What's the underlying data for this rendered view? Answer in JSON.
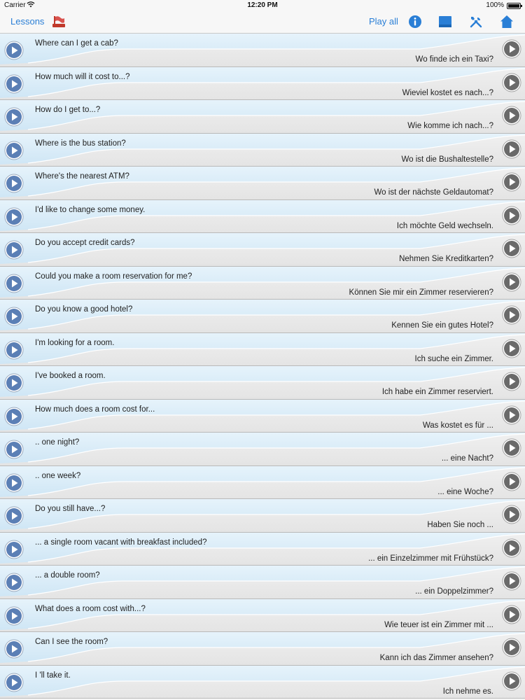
{
  "status": {
    "carrier": "Carrier",
    "time": "12:20 PM",
    "battery": "100%"
  },
  "nav": {
    "lessons_label": "Lessons",
    "play_all_label": "Play all",
    "icons": [
      "flag-icon",
      "info-icon",
      "square-icon",
      "tools-icon",
      "home-icon"
    ],
    "accent": "#2a7fd6"
  },
  "colors": {
    "row_top": "#cfe6f5",
    "row_bottom": "#e4e4e4",
    "play_left": "#5b7fb5",
    "play_right": "#6a6a6a"
  },
  "phrases": [
    {
      "en": "Where can I get a cab?",
      "de": "Wo finde ich ein Taxi?"
    },
    {
      "en": "How much will it cost to...?",
      "de": "Wieviel kostet es nach...?"
    },
    {
      "en": "How do I get to...?",
      "de": "Wie komme ich nach...?"
    },
    {
      "en": "Where is the bus station?",
      "de": "Wo ist die Bushaltestelle?"
    },
    {
      "en": "Where's the nearest ATM?",
      "de": "Wo ist der nächste Geldautomat?"
    },
    {
      "en": "I'd like to change some money.",
      "de": "Ich möchte Geld wechseln."
    },
    {
      "en": "Do you accept credit cards?",
      "de": "Nehmen Sie Kreditkarten?"
    },
    {
      "en": "Could you make a room reservation for me?",
      "de": "Können Sie mir ein Zimmer reservieren?"
    },
    {
      "en": "Do you know a good hotel?",
      "de": "Kennen Sie ein gutes Hotel?"
    },
    {
      "en": "I'm looking for a room.",
      "de": "Ich suche ein Zimmer."
    },
    {
      "en": "I've booked a room.",
      "de": "Ich habe ein Zimmer reserviert."
    },
    {
      "en": "How much does a room cost for...",
      "de": "Was kostet es für ..."
    },
    {
      "en": ".. one night?",
      "de": "... eine Nacht?"
    },
    {
      "en": ".. one week?",
      "de": "... eine Woche?"
    },
    {
      "en": "Do you still have...?",
      "de": "Haben Sie noch ..."
    },
    {
      "en": "... a single room vacant with breakfast included?",
      "de": "... ein Einzelzimmer mit Frühstück?"
    },
    {
      "en": "... a double room?",
      "de": "... ein Doppelzimmer?"
    },
    {
      "en": "What does a room cost with...?",
      "de": "Wie teuer ist ein Zimmer mit ..."
    },
    {
      "en": "Can I see the room?",
      "de": "Kann ich das Zimmer ansehen?"
    },
    {
      "en": "I 'll take it.",
      "de": "Ich nehme es."
    }
  ]
}
